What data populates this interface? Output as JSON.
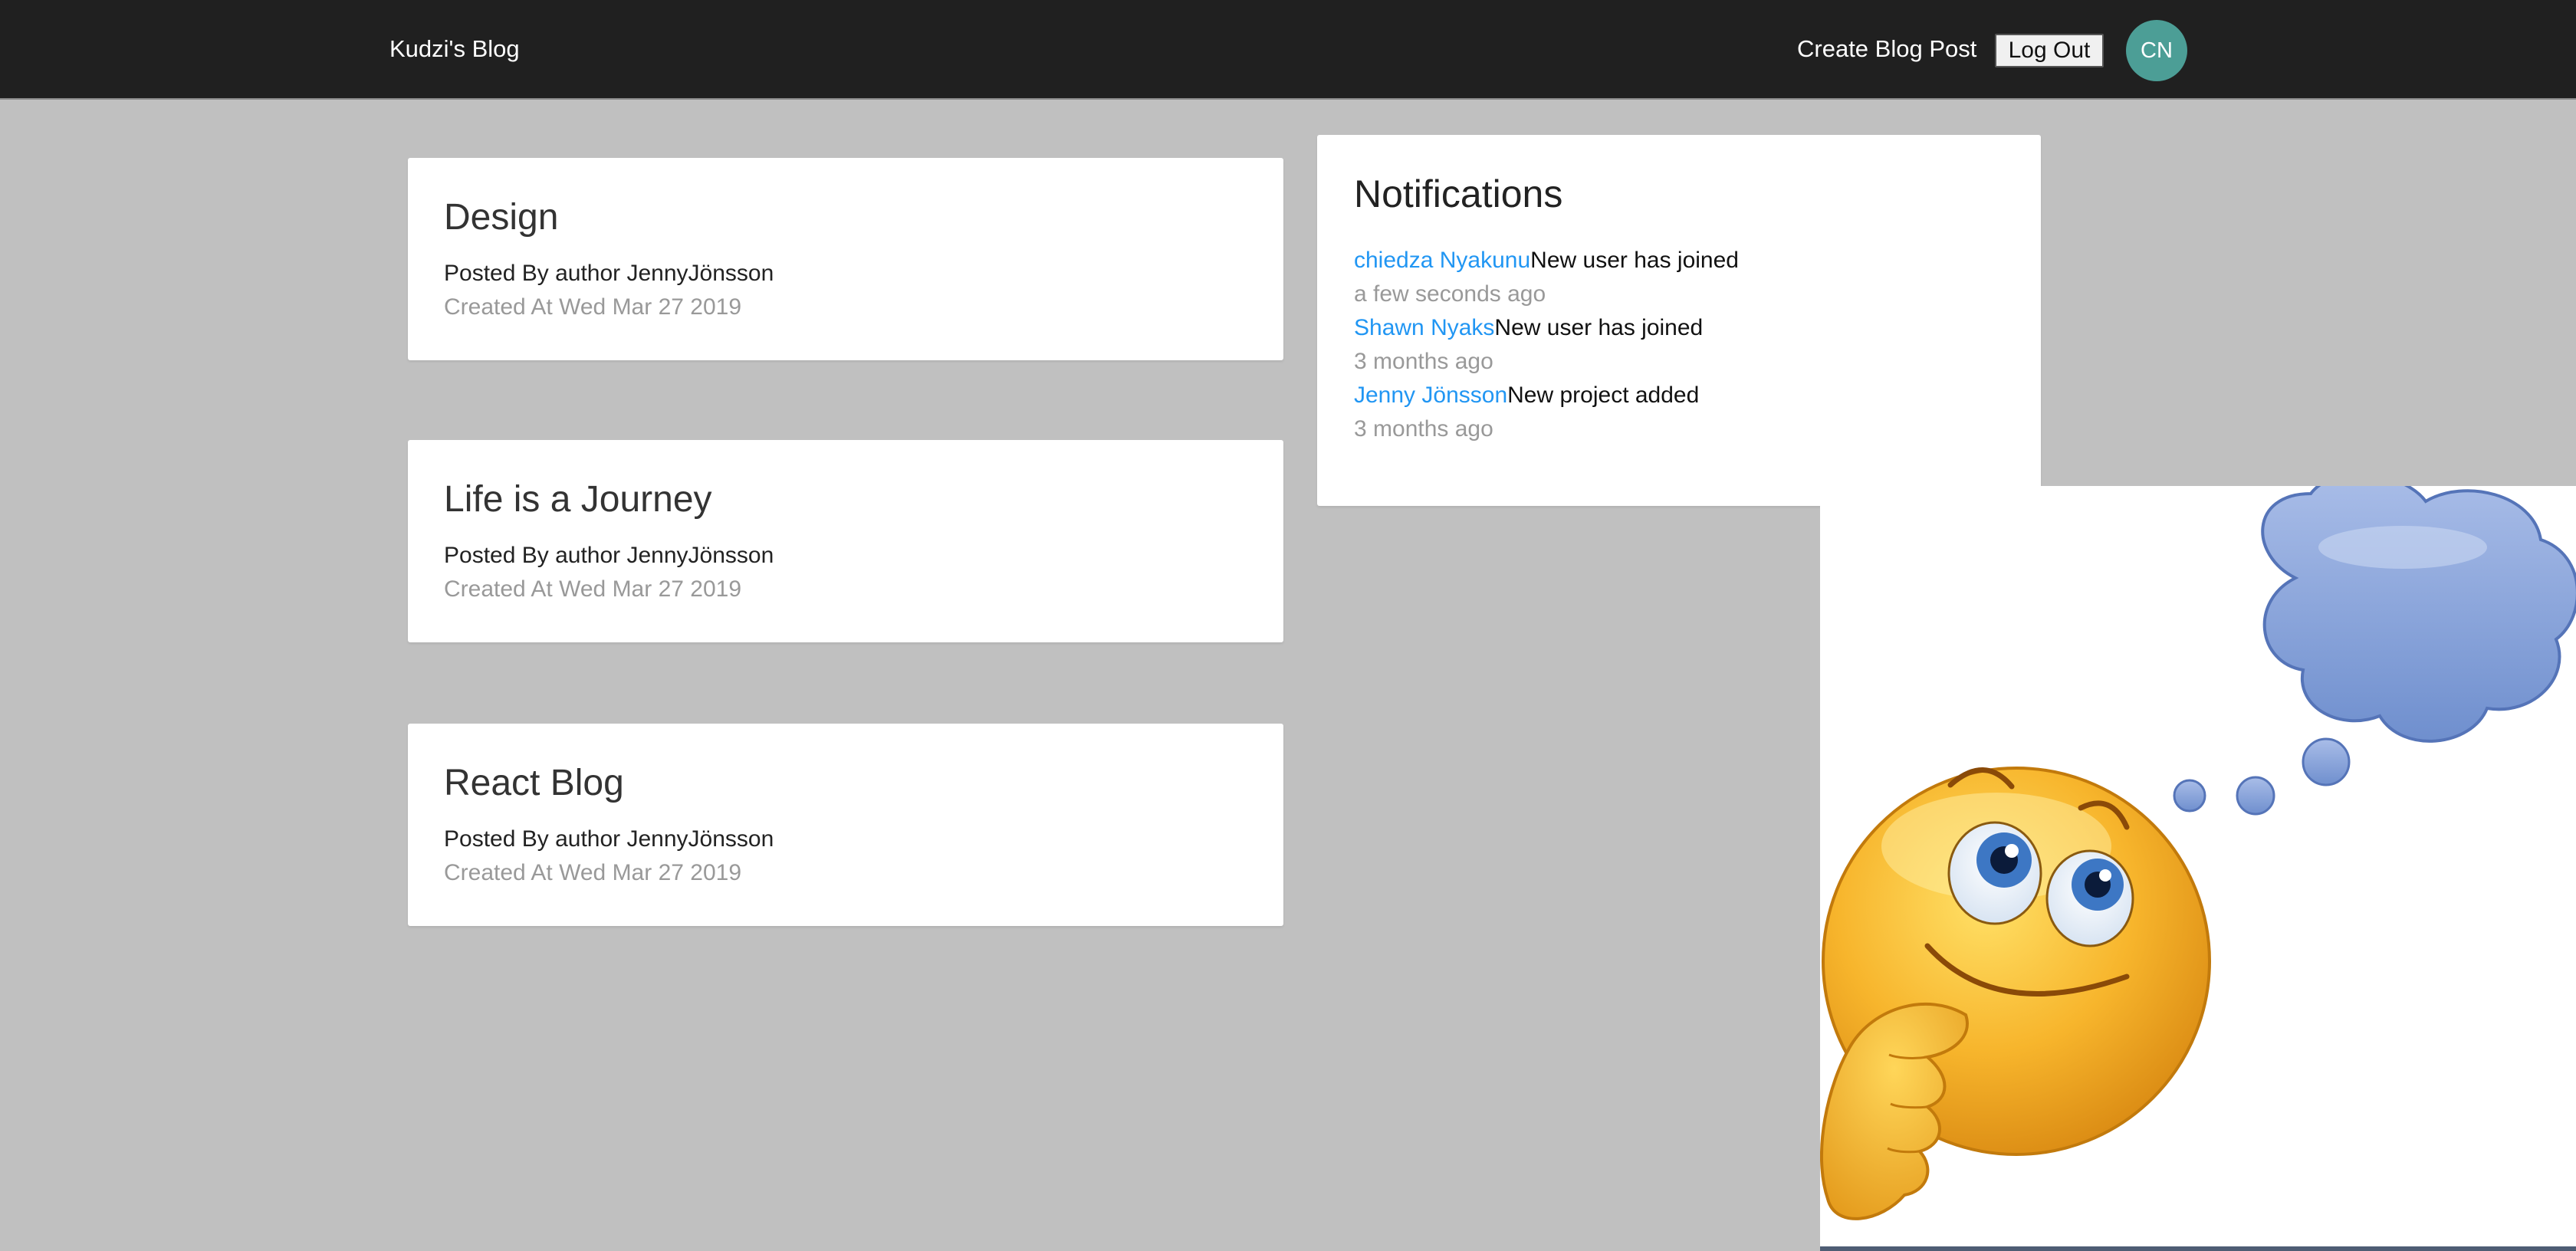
{
  "navbar": {
    "brand": "Kudzi's Blog",
    "create_link": "Create Blog Post",
    "logout_label": "Log Out",
    "avatar_initials": "CN"
  },
  "posts": [
    {
      "title": "Design",
      "author": "Posted By author JennyJönsson",
      "date": "Created At Wed Mar 27 2019"
    },
    {
      "title": "Life is a Journey",
      "author": "Posted By author JennyJönsson",
      "date": "Created At Wed Mar 27 2019"
    },
    {
      "title": "React Blog",
      "author": "Posted By author JennyJönsson",
      "date": "Created At Wed Mar 27 2019"
    }
  ],
  "notifications": {
    "title": "Notifications",
    "items": [
      {
        "user": "chiedza Nyakunu",
        "message": "New user has joined",
        "time": "a few seconds ago"
      },
      {
        "user": "Shawn Nyaks",
        "message": "New user has joined",
        "time": "3 months ago"
      },
      {
        "user": "Jenny Jönsson",
        "message": "New project added",
        "time": "3 months ago"
      }
    ]
  },
  "image": {
    "icon": "thinking-emoji-icon"
  },
  "colors": {
    "navbar_bg": "#202020",
    "page_bg": "#c0c0c0",
    "avatar_bg": "#4c9e96",
    "link": "#2196f3",
    "muted": "#999999"
  }
}
